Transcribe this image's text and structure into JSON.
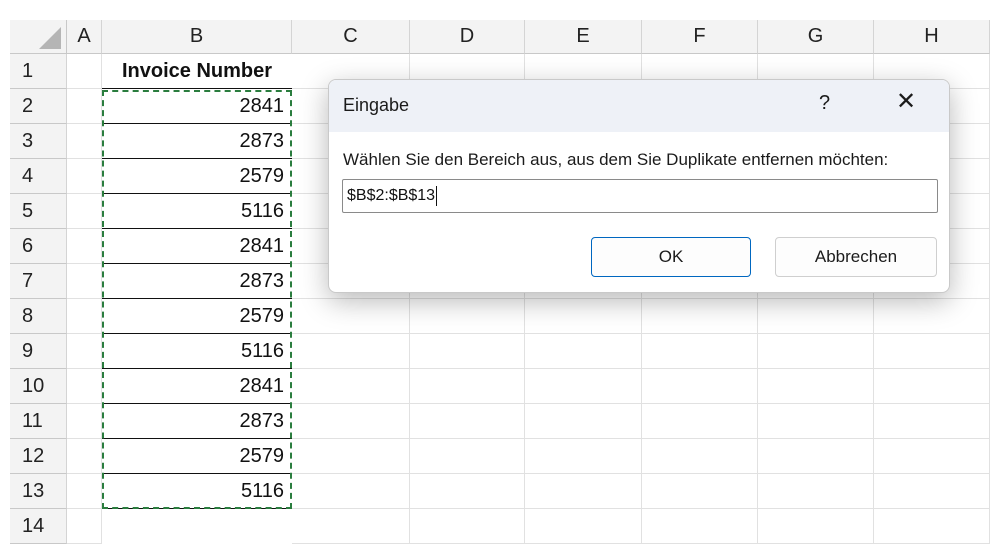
{
  "spreadsheet": {
    "columns": [
      "A",
      "B",
      "C",
      "D",
      "E",
      "F",
      "G",
      "H"
    ],
    "rows": [
      "1",
      "2",
      "3",
      "4",
      "5",
      "6",
      "7",
      "8",
      "9",
      "10",
      "11",
      "12",
      "13",
      "14"
    ],
    "header_cell": "Invoice Number",
    "values": [
      "2841",
      "2873",
      "2579",
      "5116",
      "2841",
      "2873",
      "2579",
      "5116",
      "2841",
      "2873",
      "2579",
      "5116"
    ]
  },
  "dialog": {
    "title": "Eingabe",
    "help_symbol": "?",
    "close_symbol": "✕",
    "prompt": "Wählen Sie den Bereich aus, aus dem Sie Duplikate entfernen möchten:",
    "input_value": "$B$2:$B$13",
    "ok_label": "OK",
    "cancel_label": "Abbrechen"
  },
  "colors": {
    "selection_marquee": "#2a7d3e",
    "ok_border": "#0067c0"
  }
}
